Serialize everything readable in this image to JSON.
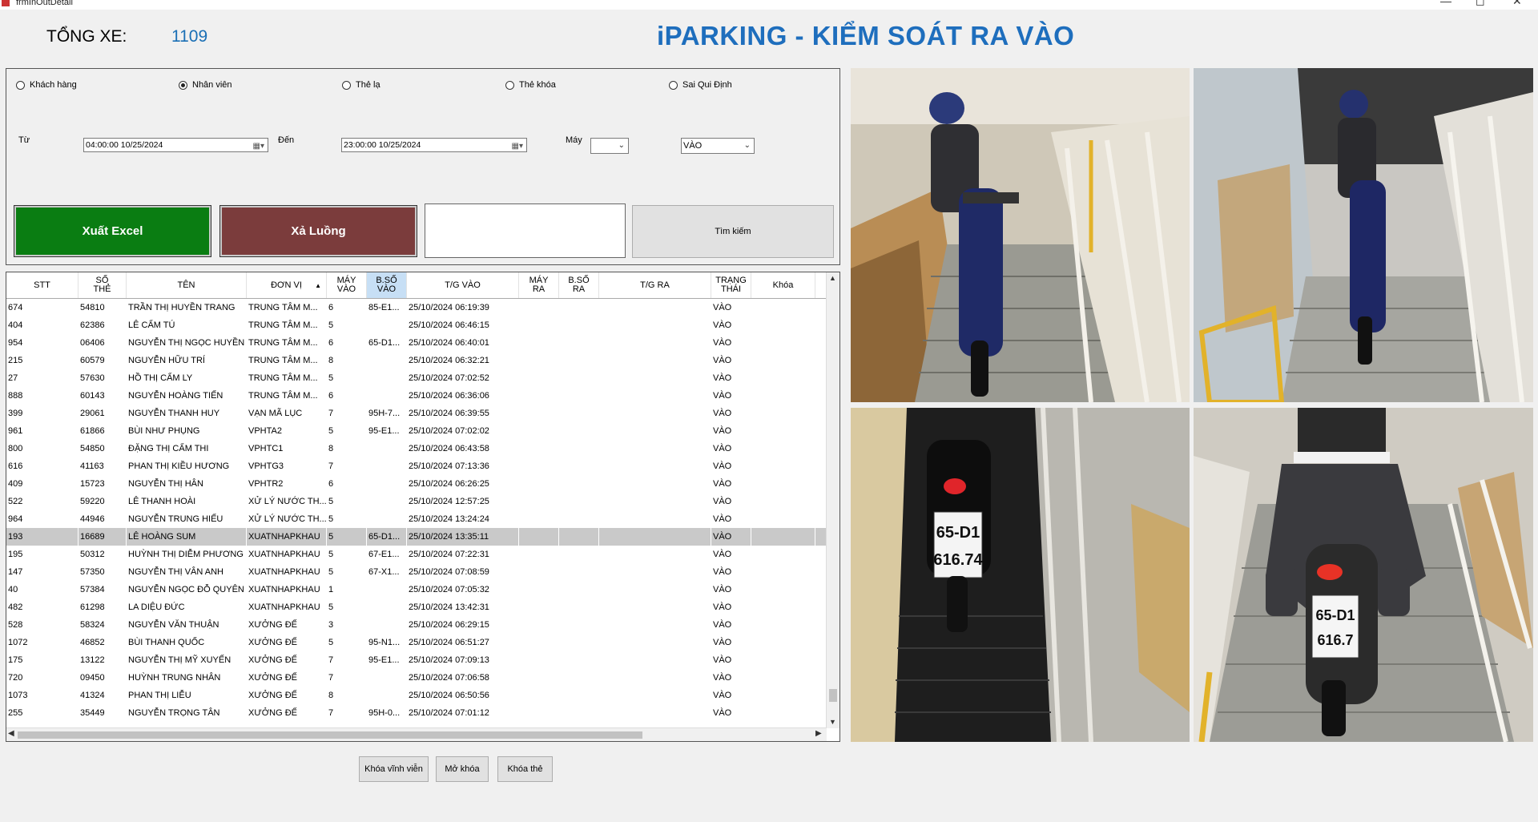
{
  "window": {
    "title": "frmInOutDetail"
  },
  "header": {
    "count_label": "TỔNG XE:",
    "count_value": "1109",
    "app_title": "iPARKING - KIỂM SOÁT RA VÀO"
  },
  "filters": {
    "radios": [
      {
        "label": "Khách hàng",
        "checked": false
      },
      {
        "label": "Nhân viên",
        "checked": true
      },
      {
        "label": "Thẻ lạ",
        "checked": false
      },
      {
        "label": "Thẻ khóa",
        "checked": false
      },
      {
        "label": "Sai Qui Định",
        "checked": false
      }
    ],
    "from_label": "Từ",
    "from_value": "04:00:00 10/25/2024",
    "to_label": "Đến",
    "to_value": "23:00:00 10/25/2024",
    "machine_label": "Máy",
    "machine_value": "",
    "direction_value": "VÀO"
  },
  "actions": {
    "export_label": "Xuất Excel",
    "release_label": "Xả Luồng",
    "search_label": "Tìm kiếm",
    "text_value": ""
  },
  "table": {
    "columns": [
      "STT",
      "SỐ THẺ",
      "TÊN",
      "ĐƠN VỊ",
      "MÁY VÀO",
      "B.SỐ VÀO",
      "T/G VÀO",
      "MÁY RA",
      "B.SỐ RA",
      "T/G RA",
      "TRẠNG THÁI",
      "Khóa"
    ],
    "rows": [
      [
        "674",
        "54810",
        "TRẦN THỊ HUYỀN TRANG",
        "TRUNG TÂM M...",
        "6",
        "85-E1...",
        "25/10/2024 06:19:39",
        "",
        "",
        "",
        "VÀO",
        ""
      ],
      [
        "404",
        "62386",
        "LÊ CẨM TÚ",
        "TRUNG TÂM M...",
        "5",
        "",
        "25/10/2024 06:46:15",
        "",
        "",
        "",
        "VÀO",
        ""
      ],
      [
        "954",
        "06406",
        "NGUYỄN THỊ NGỌC HUYỀN",
        "TRUNG TÂM M...",
        "6",
        "65-D1...",
        "25/10/2024 06:40:01",
        "",
        "",
        "",
        "VÀO",
        ""
      ],
      [
        "215",
        "60579",
        "NGUYỄN HỮU TRÍ",
        "TRUNG TÂM M...",
        "8",
        "",
        "25/10/2024 06:32:21",
        "",
        "",
        "",
        "VÀO",
        ""
      ],
      [
        "27",
        "57630",
        "HỒ THỊ CẨM LY",
        "TRUNG TÂM M...",
        "5",
        "",
        "25/10/2024 07:02:52",
        "",
        "",
        "",
        "VÀO",
        ""
      ],
      [
        "888",
        "60143",
        "NGUYỄN HOÀNG TIẾN",
        "TRUNG TÂM M...",
        "6",
        "",
        "25/10/2024 06:36:06",
        "",
        "",
        "",
        "VÀO",
        ""
      ],
      [
        "399",
        "29061",
        "NGUYỄN THANH HUY",
        "VẠN MÃ LỤC",
        "7",
        "95H-7...",
        "25/10/2024 06:39:55",
        "",
        "",
        "",
        "VÀO",
        ""
      ],
      [
        "961",
        "61866",
        "BÙI NHƯ PHỤNG",
        "VPHTA2",
        "5",
        "95-E1...",
        "25/10/2024 07:02:02",
        "",
        "",
        "",
        "VÀO",
        ""
      ],
      [
        "800",
        "54850",
        "ĐẶNG THỊ CẨM THI",
        "VPHTC1",
        "8",
        "",
        "25/10/2024 06:43:58",
        "",
        "",
        "",
        "VÀO",
        ""
      ],
      [
        "616",
        "41163",
        "PHAN THỊ KIỀU HƯƠNG",
        "VPHTG3",
        "7",
        "",
        "25/10/2024 07:13:36",
        "",
        "",
        "",
        "VÀO",
        ""
      ],
      [
        "409",
        "15723",
        "NGUYỄN THỊ HÂN",
        "VPHTR2",
        "6",
        "",
        "25/10/2024 06:26:25",
        "",
        "",
        "",
        "VÀO",
        ""
      ],
      [
        "522",
        "59220",
        "LÊ THANH HOÀI",
        "XỬ LÝ NƯỚC TH...",
        "5",
        "",
        "25/10/2024 12:57:25",
        "",
        "",
        "",
        "VÀO",
        ""
      ],
      [
        "964",
        "44946",
        "NGUYỄN TRUNG HIẾU",
        "XỬ LÝ NƯỚC TH...",
        "5",
        "",
        "25/10/2024 13:24:24",
        "",
        "",
        "",
        "VÀO",
        ""
      ],
      [
        "193",
        "16689",
        "LÊ HOÀNG SUM",
        "XUATNHAPKHAU",
        "5",
        "65-D1...",
        "25/10/2024 13:35:11",
        "",
        "",
        "",
        "VÀO",
        ""
      ],
      [
        "195",
        "50312",
        "HUỲNH THỊ DIỄM PHƯƠNG",
        "XUATNHAPKHAU",
        "5",
        "67-E1...",
        "25/10/2024 07:22:31",
        "",
        "",
        "",
        "VÀO",
        ""
      ],
      [
        "147",
        "57350",
        "NGUYỄN THỊ VÂN ANH",
        "XUATNHAPKHAU",
        "5",
        "67-X1...",
        "25/10/2024 07:08:59",
        "",
        "",
        "",
        "VÀO",
        ""
      ],
      [
        "40",
        "57384",
        "NGUYỄN NGỌC ĐỖ QUYÊN",
        "XUATNHAPKHAU",
        "1",
        "",
        "25/10/2024 07:05:32",
        "",
        "",
        "",
        "VÀO",
        ""
      ],
      [
        "482",
        "61298",
        "LA DIỆU ĐỨC",
        "XUATNHAPKHAU",
        "5",
        "",
        "25/10/2024 13:42:31",
        "",
        "",
        "",
        "VÀO",
        ""
      ],
      [
        "528",
        "58324",
        "NGUYỄN VĂN THUẬN",
        "XƯỞNG ĐẾ",
        "3",
        "",
        "25/10/2024 06:29:15",
        "",
        "",
        "",
        "VÀO",
        ""
      ],
      [
        "1072",
        "46852",
        "BÙI THANH QUỐC",
        "XƯỞNG ĐẾ",
        "5",
        "95-N1...",
        "25/10/2024 06:51:27",
        "",
        "",
        "",
        "VÀO",
        ""
      ],
      [
        "175",
        "13122",
        "NGUYỄN THỊ MỸ XUYẾN",
        "XƯỞNG ĐẾ",
        "7",
        "95-E1...",
        "25/10/2024 07:09:13",
        "",
        "",
        "",
        "VÀO",
        ""
      ],
      [
        "720",
        "09450",
        "HUỲNH TRUNG NHÂN",
        "XƯỞNG ĐẾ",
        "7",
        "",
        "25/10/2024 07:06:58",
        "",
        "",
        "",
        "VÀO",
        ""
      ],
      [
        "1073",
        "41324",
        "PHAN THỊ LIỄU",
        "XƯỞNG ĐẾ",
        "8",
        "",
        "25/10/2024 06:50:56",
        "",
        "",
        "",
        "VÀO",
        ""
      ],
      [
        "255",
        "35449",
        "NGUYỄN TRỌNG TÂN",
        "XƯỞNG ĐẾ",
        "7",
        "95H-0...",
        "25/10/2024 07:01:12",
        "",
        "",
        "",
        "VÀO",
        ""
      ]
    ],
    "selected_row": 13
  },
  "bottom_buttons": {
    "lock_forever": "Khóa vĩnh viễn",
    "unlock": "Mở khóa",
    "lock_card": "Khóa thẻ"
  },
  "plates": {
    "plate1_line1": "65-D1",
    "plate1_line2": "616.74",
    "plate2_line1": "65-D1",
    "plate2_line2": "616.7"
  },
  "colors": {
    "title_blue": "#1e6ebd",
    "count_blue": "#1a6fb5",
    "export_green": "#0a7d12",
    "release_brown": "#7b3c3c",
    "selected_row": "#c9c9c9"
  }
}
